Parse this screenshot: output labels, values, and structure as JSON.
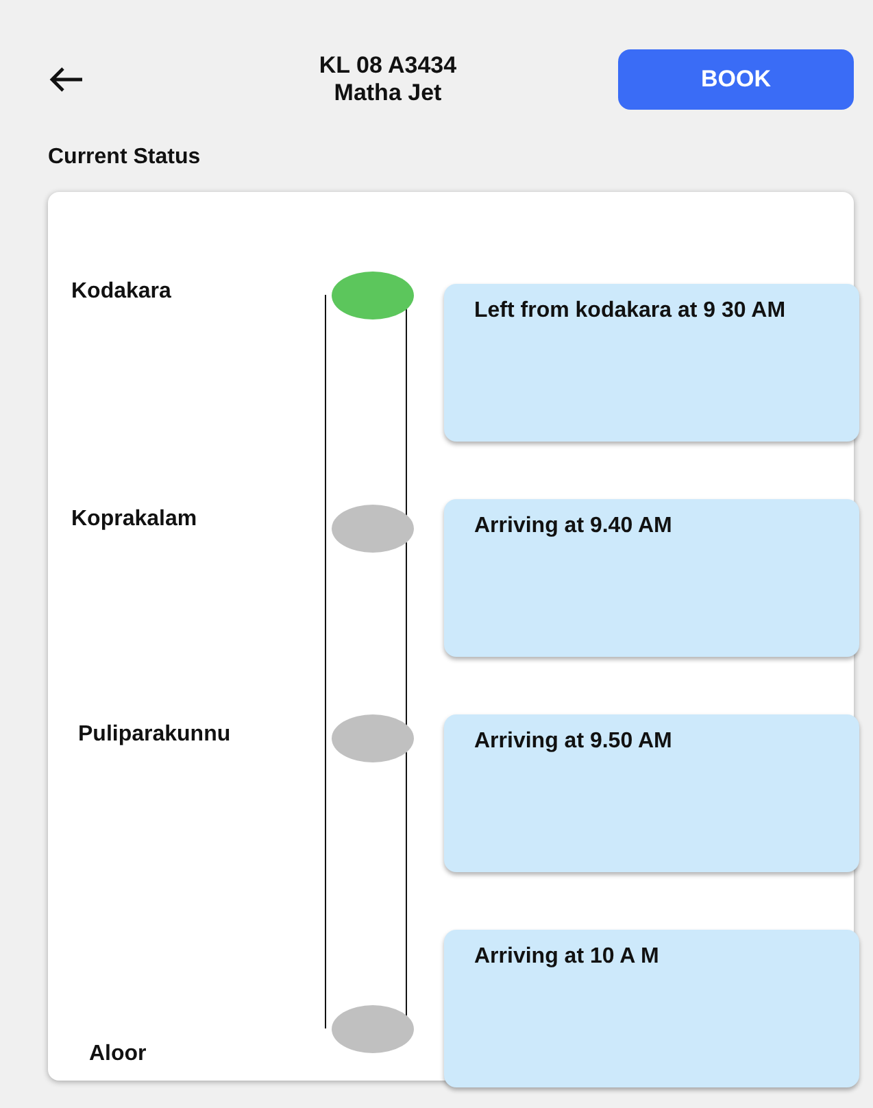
{
  "header": {
    "title": "KL 08 A3434",
    "subtitle": "Matha Jet",
    "action": "BOOK"
  },
  "section_title": "Current Status",
  "stops": [
    {
      "name": "Kodakara",
      "reached": true,
      "message": "Left from kodakara at 9 30 AM"
    },
    {
      "name": "Koprakalam",
      "reached": false,
      "message": "Arriving at 9.40 AM"
    },
    {
      "name": "Puliparakunnu",
      "reached": false,
      "message": "Arriving at 9.50 AM"
    },
    {
      "name": "Aloor",
      "reached": false,
      "message": "Arriving at 10 A M"
    }
  ]
}
